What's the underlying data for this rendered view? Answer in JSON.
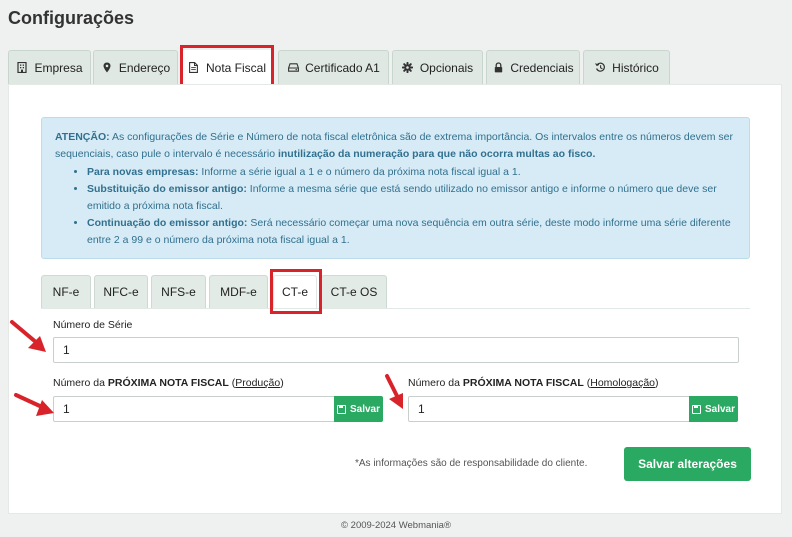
{
  "page": {
    "title": "Configurações"
  },
  "main_tabs": [
    {
      "label": "Empresa",
      "icon": "building-icon"
    },
    {
      "label": "Endereço",
      "icon": "map-marker-icon"
    },
    {
      "label": "Nota Fiscal",
      "icon": "file-icon",
      "active": true
    },
    {
      "label": "Certificado A1",
      "icon": "hdd-icon"
    },
    {
      "label": "Opcionais",
      "icon": "gear-icon"
    },
    {
      "label": "Credenciais",
      "icon": "lock-icon"
    },
    {
      "label": "Histórico",
      "icon": "history-icon"
    }
  ],
  "alert": {
    "title": "ATENÇÃO:",
    "text1": " As configurações de Série e Número de nota fiscal eletrônica são de extrema importância. Os intervalos entre os números devem ser sequenciais, caso pule o intervalo é necessário ",
    "bold": "inutilização da numeração para que não ocorra multas ao fisco.",
    "items": [
      {
        "strong": "Para novas empresas:",
        "text": " Informe a série igual a 1 e o número da próxima nota fiscal igual a 1."
      },
      {
        "strong": "Substituição do emissor antigo:",
        "text": " Informe a mesma série que está sendo utilizado no emissor antigo e informe o número que deve ser emitido a próxima nota fiscal."
      },
      {
        "strong": "Continuação do emissor antigo:",
        "text": " Será necessário começar uma nova sequência em outra série, deste modo informe uma série diferente entre 2 a 99 e o número da próxima nota fiscal igual a 1."
      }
    ]
  },
  "sub_tabs": [
    {
      "label": "NF-e"
    },
    {
      "label": "NFC-e"
    },
    {
      "label": "NFS-e"
    },
    {
      "label": "MDF-e"
    },
    {
      "label": "CT-e",
      "active": true
    },
    {
      "label": "CT-e OS"
    }
  ],
  "form": {
    "serie_label": "Número de Série",
    "serie_value": "1",
    "next_label_prefix": "Número da ",
    "next_label_bold": "PRÓXIMA NOTA FISCAL",
    "next_label_open": " (",
    "next_label_close": ")",
    "producao_env": "Produção",
    "homologacao_env": "Homologação",
    "producao_value": "1",
    "homologacao_value": "1",
    "save_label": "Salvar",
    "disclaimer": "*As informações são de responsabilidade do cliente.",
    "save_all_label": "Salvar alterações"
  },
  "footer": {
    "text": "© 2009-2024 Webmania®"
  },
  "colors": {
    "accent": "#2aa962",
    "highlight": "#d9232a",
    "alert_bg": "#d6ebf5",
    "alert_text": "#31708f"
  }
}
